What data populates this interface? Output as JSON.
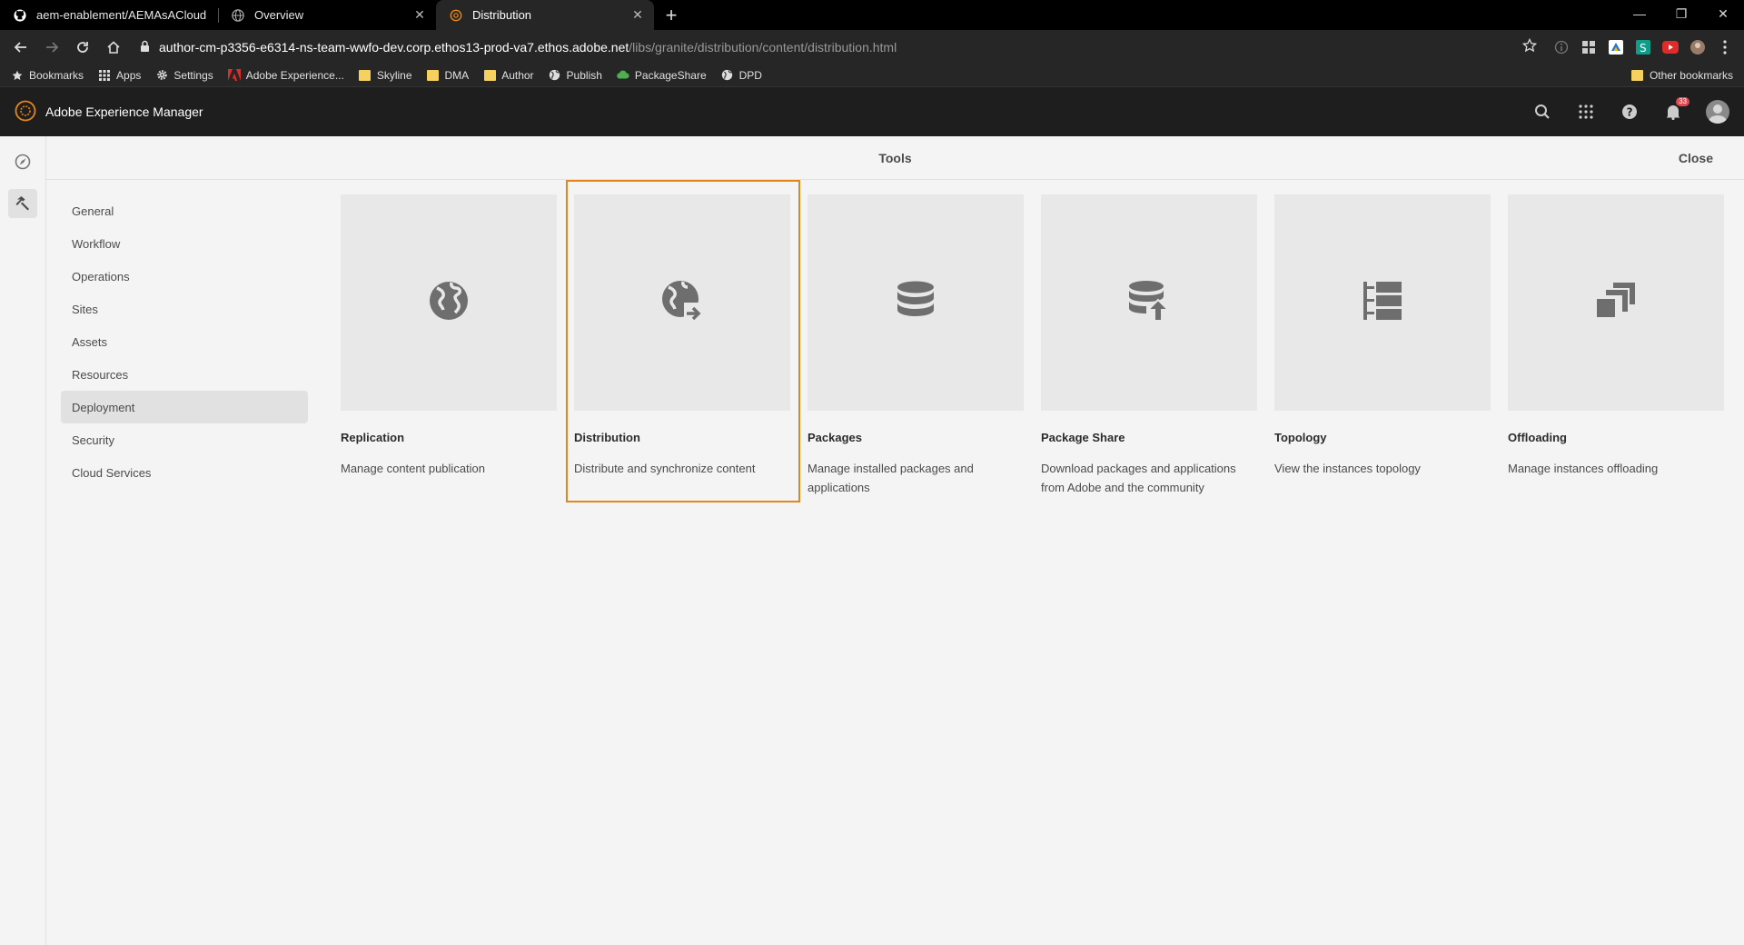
{
  "browser": {
    "tabs": [
      {
        "title": "aem-enablement/AEMAsACloud",
        "icon": "github-icon",
        "active": false
      },
      {
        "title": "Overview",
        "icon": "globe-icon",
        "active": false
      },
      {
        "title": "Distribution",
        "icon": "aem-icon",
        "active": true
      }
    ],
    "url": {
      "host": "author-cm-p3356-e6314-ns-team-wwfo-dev.corp.ethos13-prod-va7.ethos.adobe.net",
      "path": "/libs/granite/distribution/content/distribution.html"
    },
    "bookmarks": [
      {
        "label": "Bookmarks",
        "icon": "star-icon"
      },
      {
        "label": "Apps",
        "icon": "apps-grid-icon"
      },
      {
        "label": "Settings",
        "icon": "gear-icon"
      },
      {
        "label": "Adobe Experience...",
        "icon": "adobe-icon"
      },
      {
        "label": "Skyline",
        "icon": "folder-icon"
      },
      {
        "label": "DMA",
        "icon": "folder-icon"
      },
      {
        "label": "Author",
        "icon": "folder-icon"
      },
      {
        "label": "Publish",
        "icon": "globe-icon"
      },
      {
        "label": "PackageShare",
        "icon": "cloud-icon"
      },
      {
        "label": "DPD",
        "icon": "globe-icon"
      }
    ],
    "other_bookmarks": "Other bookmarks"
  },
  "aem": {
    "product_name": "Adobe Experience Manager",
    "notification_count": "33",
    "page_title": "Tools",
    "close_label": "Close",
    "nav": [
      {
        "label": "General",
        "selected": false
      },
      {
        "label": "Workflow",
        "selected": false
      },
      {
        "label": "Operations",
        "selected": false
      },
      {
        "label": "Sites",
        "selected": false
      },
      {
        "label": "Assets",
        "selected": false
      },
      {
        "label": "Resources",
        "selected": false
      },
      {
        "label": "Deployment",
        "selected": true
      },
      {
        "label": "Security",
        "selected": false
      },
      {
        "label": "Cloud Services",
        "selected": false
      }
    ],
    "cards": [
      {
        "name": "Replication",
        "desc": "Manage content publication",
        "icon": "globe-icon"
      },
      {
        "name": "Distribution",
        "desc": "Distribute and synchronize content",
        "icon": "globe-share-icon",
        "focused": true
      },
      {
        "name": "Packages",
        "desc": "Manage installed packages and applications",
        "icon": "database-icon"
      },
      {
        "name": "Package Share",
        "desc": "Download packages and applications from Adobe and the community",
        "icon": "database-upload-icon"
      },
      {
        "name": "Topology",
        "desc": "View the instances topology",
        "icon": "topology-icon"
      },
      {
        "name": "Offloading",
        "desc": "Manage instances offloading",
        "icon": "offloading-icon"
      }
    ]
  },
  "colors": {
    "focus_outline": "#e68619",
    "header_bg": "#1e1e1e",
    "icon_gray": "#6e6e6e"
  }
}
